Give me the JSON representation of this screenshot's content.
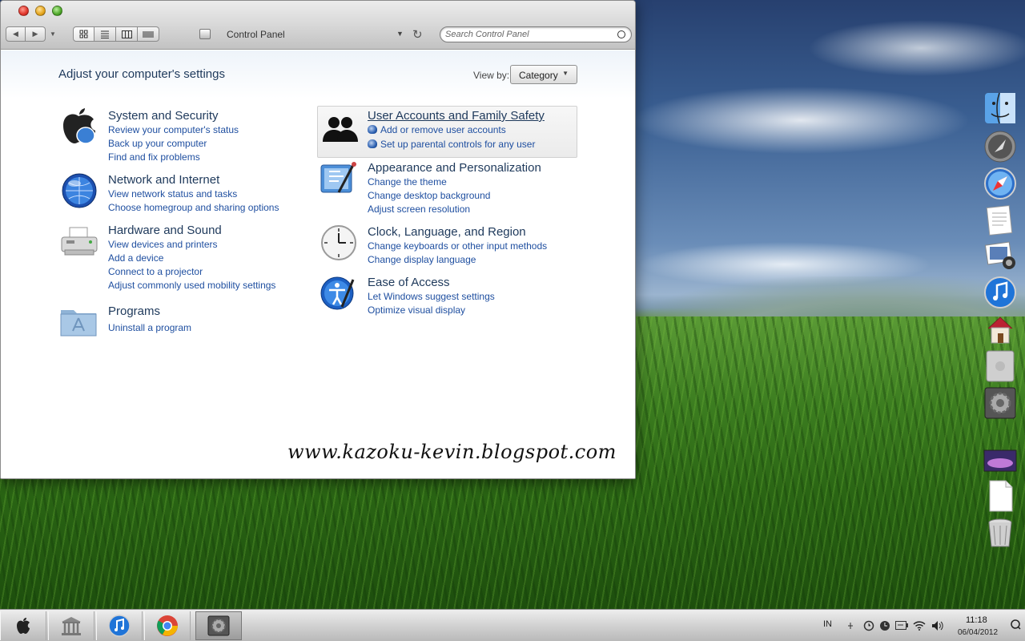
{
  "window": {
    "address": "Control Panel",
    "search_placeholder": "Search Control Panel"
  },
  "content": {
    "title": "Adjust your computer's settings",
    "view_by_label": "View by:",
    "view_by_value": "Category"
  },
  "categories": [
    {
      "title": "System and Security",
      "links": [
        "Review your computer's status",
        "Back up your computer",
        "Find and fix problems"
      ]
    },
    {
      "title": "Network and Internet",
      "links": [
        "View network status and tasks",
        "Choose homegroup and sharing options"
      ]
    },
    {
      "title": "Hardware and Sound",
      "links": [
        "View devices and printers",
        "Add a device",
        "Connect to a projector",
        "Adjust commonly used mobility settings"
      ]
    },
    {
      "title": "Programs",
      "links": [
        "Uninstall a program"
      ]
    },
    {
      "title": "User Accounts and Family Safety",
      "links": [
        "Add or remove user accounts",
        "Set up parental controls for any user"
      ]
    },
    {
      "title": "Appearance and Personalization",
      "links": [
        "Change the theme",
        "Change desktop background",
        "Adjust screen resolution"
      ]
    },
    {
      "title": "Clock, Language, and Region",
      "links": [
        "Change keyboards or other input methods",
        "Change display language"
      ]
    },
    {
      "title": "Ease of Access",
      "links": [
        "Let Windows suggest settings",
        "Optimize visual display"
      ]
    }
  ],
  "watermark": "www.kazoku-kevin.blogspot.com",
  "taskbar": {
    "language": "IN",
    "time": "11:18",
    "date": "06/04/2012"
  },
  "dock_icons": [
    "finder-icon",
    "launchpad-icon",
    "safari-icon",
    "textedit-icon",
    "photo-booth-icon",
    "itunes-icon",
    "home-icon",
    "mac-pro-icon",
    "system-preferences-icon",
    "desktop-stack-icon",
    "documents-icon",
    "trash-icon"
  ],
  "colors": {
    "link": "#1f4fa0",
    "heading": "#1e395b"
  }
}
